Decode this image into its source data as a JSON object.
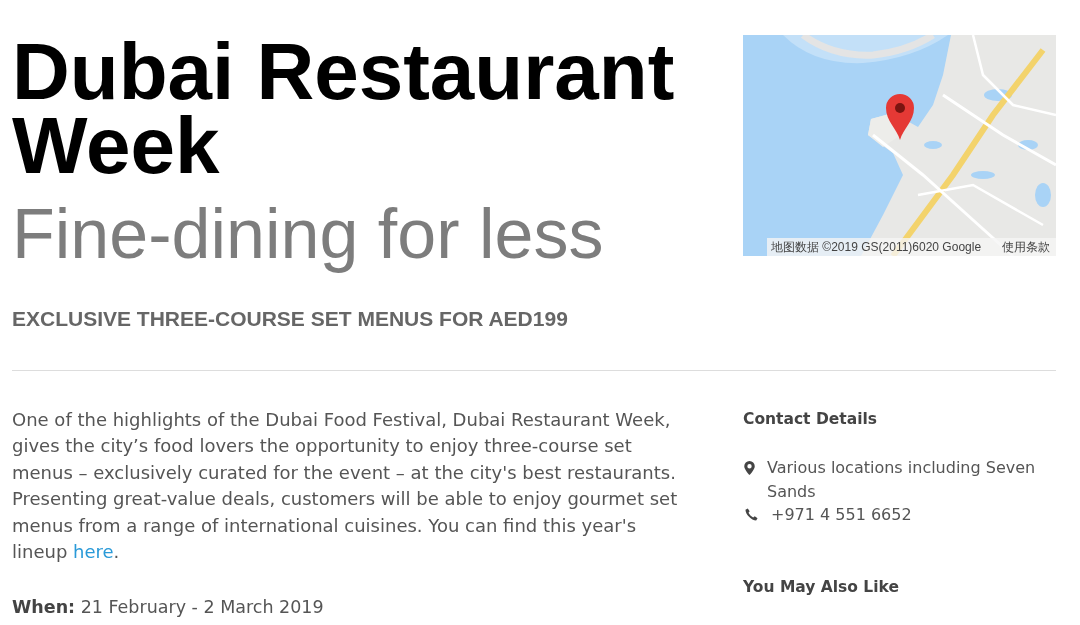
{
  "header": {
    "title": "Dubai Restaurant Week",
    "subtitle": "Fine-dining for less",
    "tagline": "EXCLUSIVE THREE-COURSE SET MENUS FOR AED199"
  },
  "map": {
    "attribution": "地图数据 ©2019 GS(2011)6020 Google",
    "terms_link": "使用条款"
  },
  "description": {
    "text": "One of the highlights of the Dubai Food Festival, Dubai Restaurant Week, gives the city’s food lovers the opportunity to enjoy three-course set menus – exclusively curated for the event – at the city's best restaurants. Presenting great-value deals, customers will be able to enjoy gourmet set menus from a range of international cuisines. You can find this year's lineup",
    "link": "here",
    "after_link": "."
  },
  "when": "**When:** 21 February - 2 March 2019",
  "contact": {
    "heading": "Contact Details",
    "items": [
      {
        "kind": "location",
        "text": "Various locations including Seven Sands"
      },
      {
        "kind": "phone",
        "text": "+971 4 551 6652"
      }
    ]
  },
  "related": {
    "heading": "You May Also Like"
  }
}
